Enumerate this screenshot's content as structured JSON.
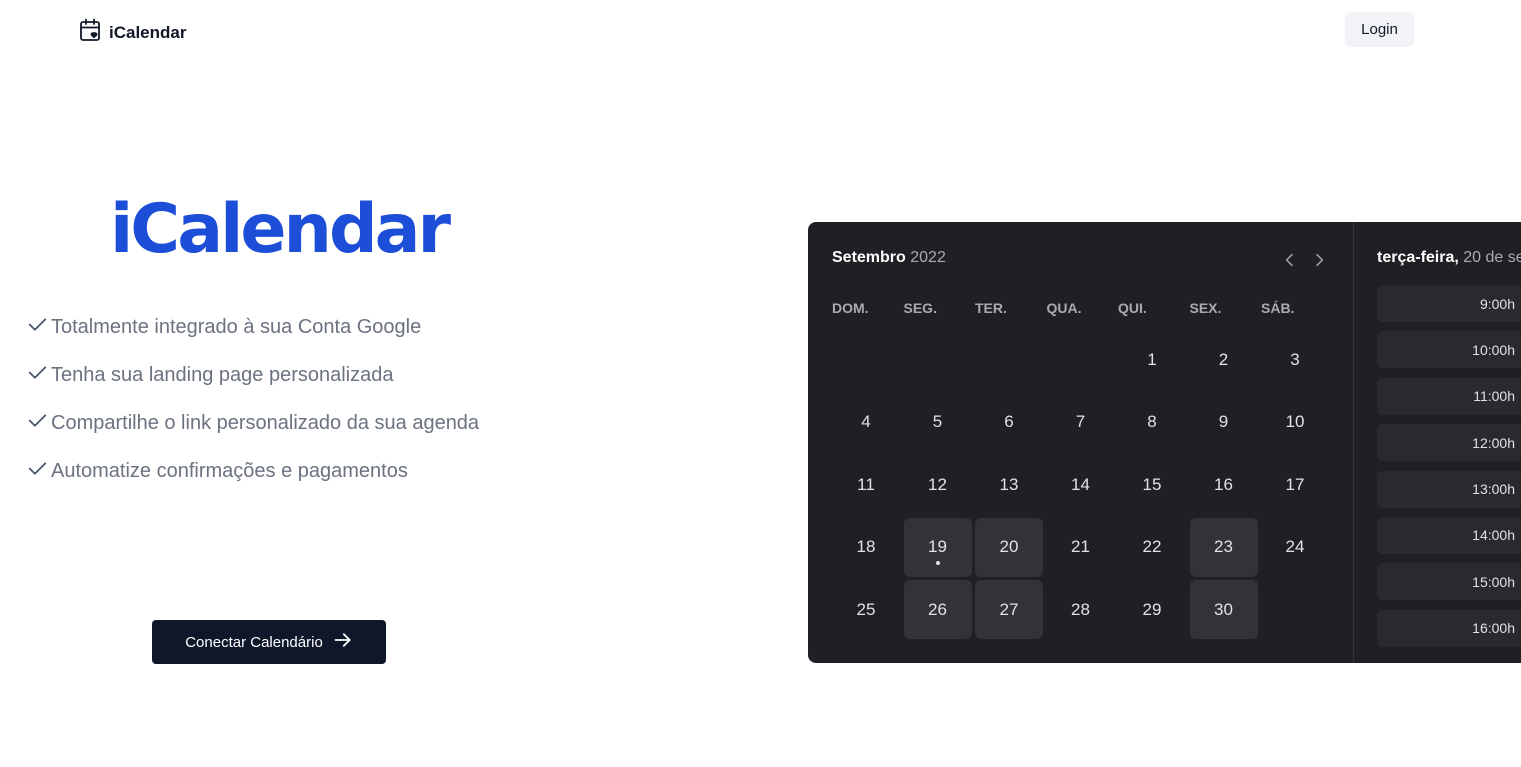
{
  "header": {
    "brand_name": "iCalendar",
    "brand_icon": "calendar-heart-icon",
    "login_label": "Login"
  },
  "hero": {
    "title": "iCalendar",
    "features": [
      "Totalmente integrado à sua Conta Google",
      "Tenha sua landing page personalizada",
      "Compartilhe o link personalizado da sua agenda",
      "Automatize confirmações e pagamentos"
    ],
    "cta_label": "Conectar Calendário"
  },
  "calendar": {
    "month": "Setembro",
    "year": "2022",
    "weekdays": [
      "DOM.",
      "SEG.",
      "TER.",
      "QUA.",
      "QUI.",
      "SEX.",
      "SÁB."
    ],
    "weeks": [
      [
        "",
        "",
        "",
        "",
        "1",
        "2",
        "3"
      ],
      [
        "4",
        "5",
        "6",
        "7",
        "8",
        "9",
        "10"
      ],
      [
        "11",
        "12",
        "13",
        "14",
        "15",
        "16",
        "17"
      ],
      [
        "18",
        "19",
        "20",
        "21",
        "22",
        "23",
        "24"
      ],
      [
        "25",
        "26",
        "27",
        "28",
        "29",
        "30",
        ""
      ]
    ],
    "available_days": [
      "19",
      "20",
      "23",
      "26",
      "27",
      "30"
    ],
    "today": "19",
    "selected_date_weekday": "terça-feira,",
    "selected_date_rest": " 20 de se",
    "time_slots": [
      "9:00h",
      "10:00h",
      "11:00h",
      "12:00h",
      "13:00h",
      "14:00h",
      "15:00h",
      "16:00h"
    ]
  },
  "colors": {
    "brand_blue": "#1d4ed8",
    "calendar_bg": "#202024",
    "cta_bg": "#0f172a"
  }
}
